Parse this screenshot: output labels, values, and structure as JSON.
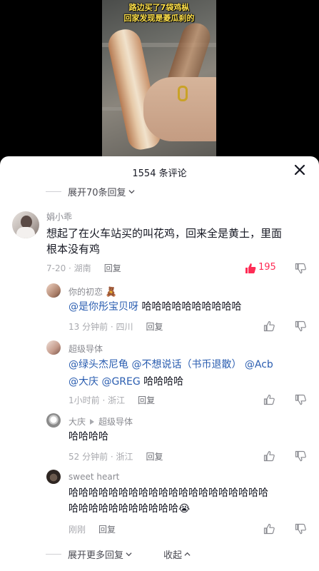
{
  "video": {
    "caption_line1": "路边买了7袋鸡枞",
    "caption_line2": "回家发现是菱瓜刹的"
  },
  "sheet": {
    "title": "1554 条评论",
    "expand_top": "展开70条回复",
    "expand_bottom": "展开更多回复",
    "collapse": "收起"
  },
  "comments": [
    {
      "name": "娟小乖",
      "text_line1": "想起了在火车站买的叫花鸡，回来全是黄土，里面",
      "text_line2": "根本没有鸡",
      "time": "7-20 · 湖南",
      "reply": "回复",
      "likes": "195"
    }
  ],
  "replies": [
    {
      "name": "你的初恋",
      "mention": "@是你彤宝贝呀",
      "text": " 哈哈哈哈哈哈哈哈哈哈",
      "time": "13 分钟前 · 四川",
      "reply": "回复"
    },
    {
      "name": "超级导体",
      "mention1": "@绿头杰尼龟",
      "mention2": "@不想说话（书币退散）",
      "mention3": "@Acb",
      "mention4": "@大庆",
      "mention5": "@GREG",
      "text": " 哈哈哈哈",
      "time": "1小时前 · 浙江",
      "reply": "回复"
    },
    {
      "name": "大庆",
      "reply_to": "超级导体",
      "text": "哈哈哈哈",
      "time": "52 分钟前 · 浙江",
      "reply": "回复"
    },
    {
      "name": "sweet heart",
      "text_line1": "哈哈哈哈哈哈哈哈哈哈哈哈哈哈哈哈哈哈哈哈",
      "text_line2": "哈哈哈哈哈哈哈哈哈哈哈",
      "emoji": "😭",
      "time": "刚刚",
      "reply": "回复"
    }
  ],
  "colors": {
    "like_active": "#fe2c55",
    "mention": "#2a5db0"
  }
}
